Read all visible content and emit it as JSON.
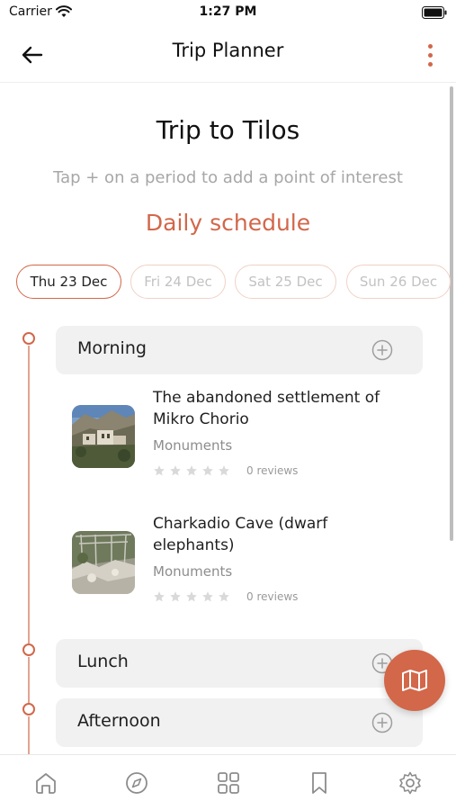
{
  "status_bar": {
    "carrier": "Carrier",
    "time": "1:27 PM"
  },
  "nav": {
    "title": "Trip Planner",
    "back_icon": "arrow-left-icon",
    "menu_icon": "more-vertical-icon"
  },
  "trip": {
    "title": "Trip to Tilos",
    "hint": "Tap + on a period to add a point of interest",
    "schedule_heading": "Daily schedule"
  },
  "dates": [
    {
      "label": "Thu 23 Dec",
      "selected": true
    },
    {
      "label": "Fri 24 Dec",
      "selected": false
    },
    {
      "label": "Sat 25 Dec",
      "selected": false
    },
    {
      "label": "Sun 26 Dec",
      "selected": false
    }
  ],
  "periods": [
    {
      "label": "Morning",
      "items": [
        {
          "title": "The abandoned settlement of Mikro Chorio",
          "category": "Monuments",
          "rating": 0,
          "reviews": "0 reviews"
        },
        {
          "title": "Charkadio Cave (dwarf elephants)",
          "category": "Monuments",
          "rating": 0,
          "reviews": "0 reviews"
        }
      ]
    },
    {
      "label": "Lunch",
      "items": []
    },
    {
      "label": "Afternoon",
      "items": []
    }
  ],
  "fab": {
    "icon": "map-icon"
  },
  "tab_bar": [
    {
      "icon": "home-icon"
    },
    {
      "icon": "compass-icon"
    },
    {
      "icon": "grid-icon"
    },
    {
      "icon": "bookmark-icon"
    },
    {
      "icon": "gear-icon"
    }
  ],
  "colors": {
    "accent": "#d2674a",
    "accent_light": "#f0d2c7",
    "period_bg": "#f1f1f1",
    "muted_text": "#a7a7a7"
  }
}
